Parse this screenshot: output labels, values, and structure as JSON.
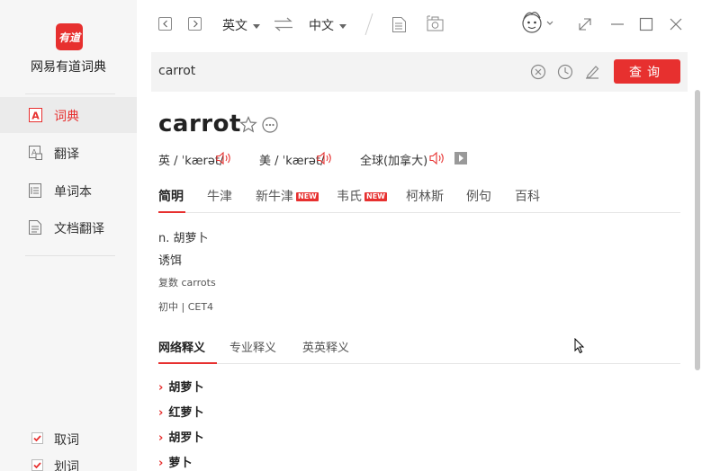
{
  "app": {
    "logo_text": "有道",
    "name": "网易有道词典"
  },
  "sidebar": {
    "items": [
      {
        "label": "词典",
        "active": true
      },
      {
        "label": "翻译",
        "active": false
      },
      {
        "label": "单词本",
        "active": false
      },
      {
        "label": "文档翻译",
        "active": false
      }
    ],
    "checks": [
      {
        "label": "取词",
        "checked": true
      },
      {
        "label": "划词",
        "checked": true
      }
    ]
  },
  "topbar": {
    "source_lang": "英文",
    "target_lang": "中文"
  },
  "search": {
    "value": "carrot",
    "button": "查询"
  },
  "entry": {
    "word": "carrot",
    "pronunciations": [
      {
        "label": "英 / ˈkærət/"
      },
      {
        "label": "美 / ˈkærət/"
      },
      {
        "label": "全球(加拿大)"
      }
    ],
    "tabs": [
      {
        "label": "简明",
        "active": true
      },
      {
        "label": "牛津",
        "active": false
      },
      {
        "label": "新牛津",
        "badge": "NEW"
      },
      {
        "label": "韦氏",
        "badge": "NEW"
      },
      {
        "label": "柯林斯"
      },
      {
        "label": "例句"
      },
      {
        "label": "百科"
      }
    ],
    "definitions": [
      "n. 胡萝卜",
      "诱饵"
    ],
    "plural": "复数 carrots",
    "levels": "初中 | CET4",
    "net_tabs": [
      {
        "label": "网络释义",
        "active": true
      },
      {
        "label": "专业释义"
      },
      {
        "label": "英英释义"
      }
    ],
    "net_items": [
      "胡萝卜",
      "红萝卜",
      "胡罗卜",
      "萝卜"
    ]
  },
  "colors": {
    "accent": "#e7302f",
    "sidebar_bg": "#f6f6f6"
  }
}
